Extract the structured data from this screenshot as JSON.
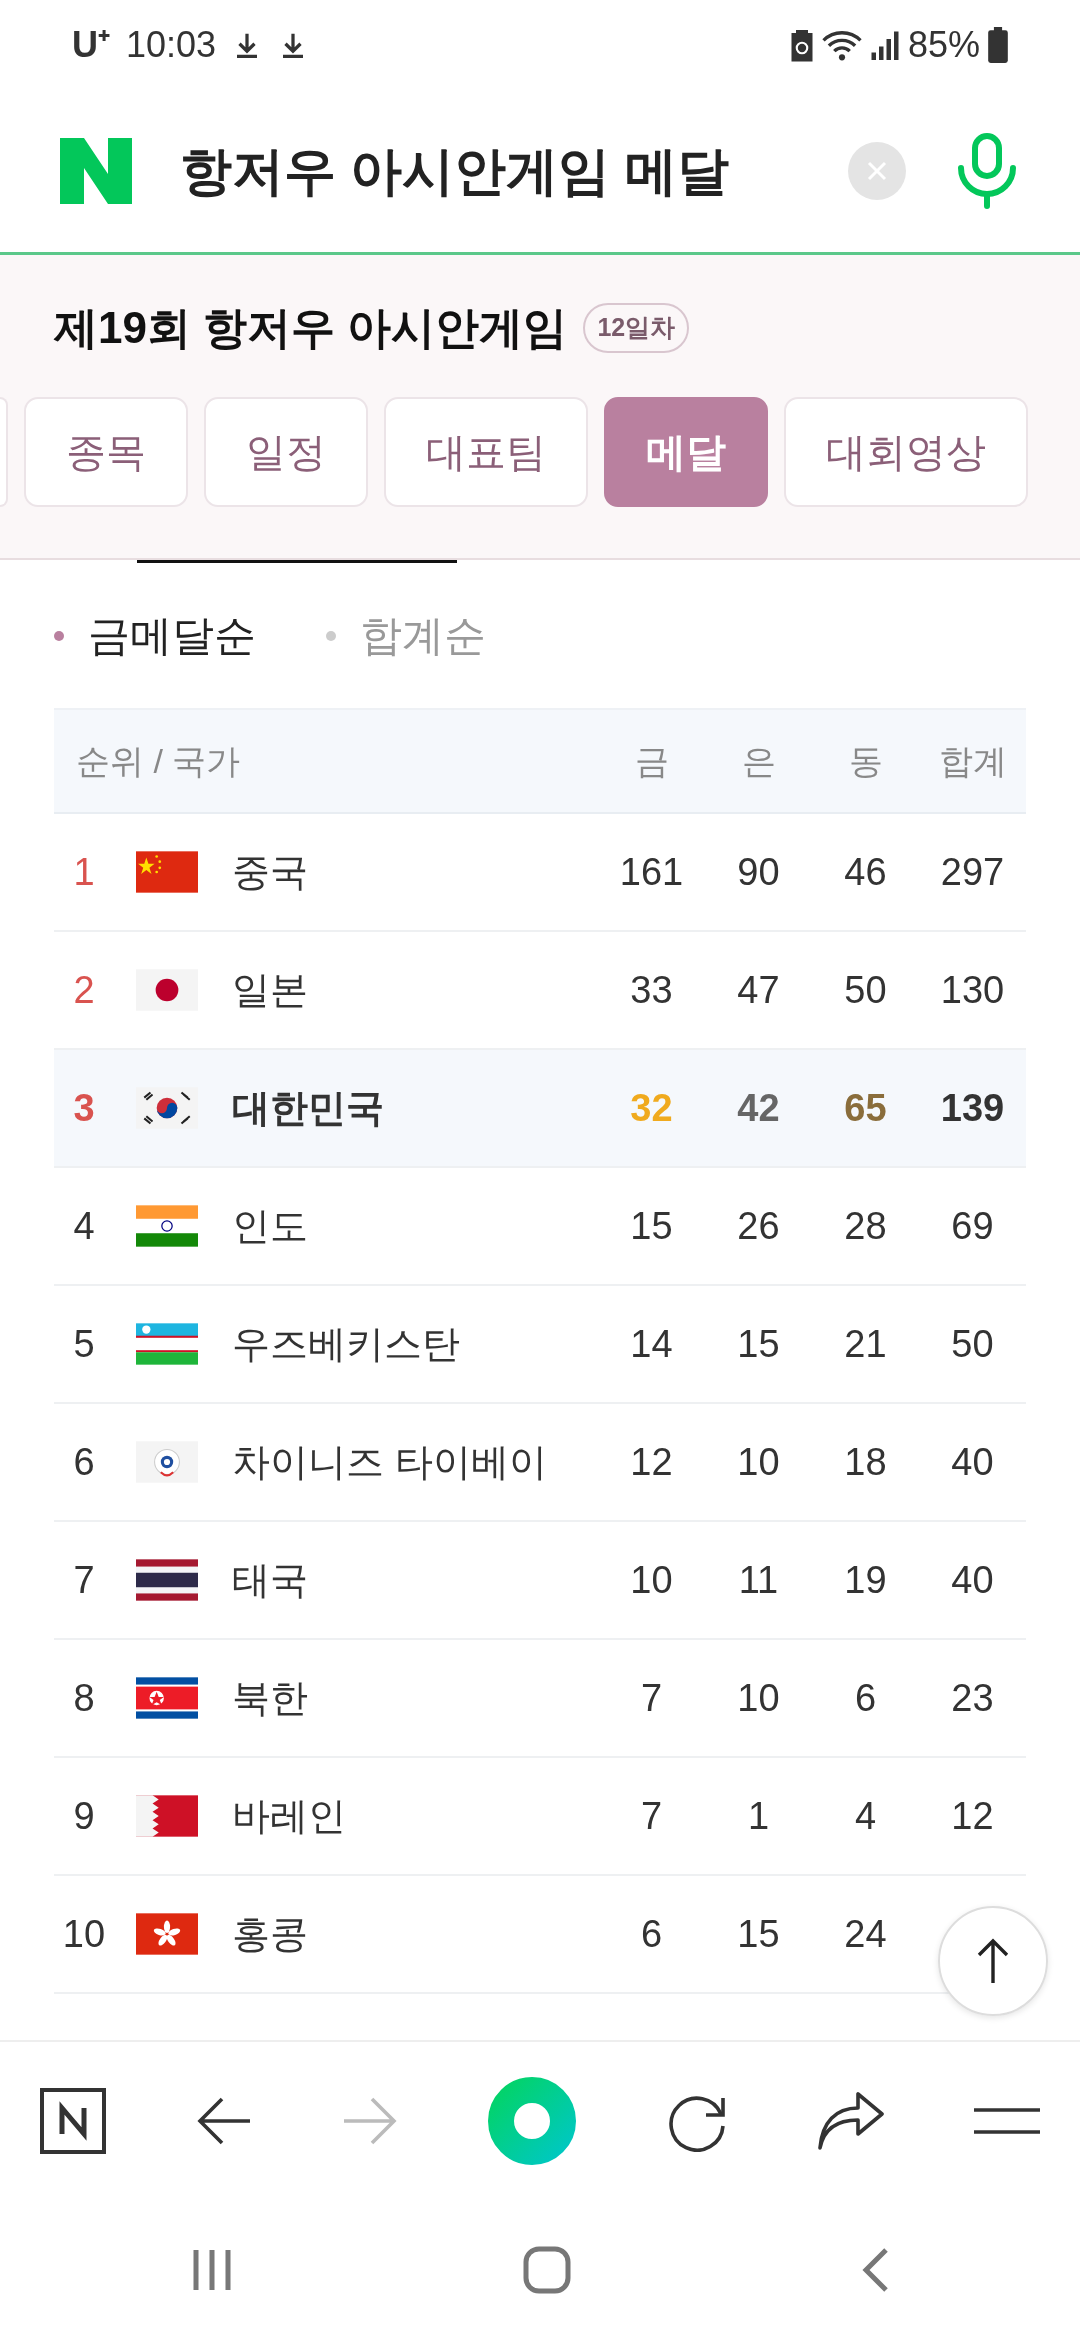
{
  "status_bar": {
    "carrier": "U⁺",
    "time": "10:03",
    "battery": "85%"
  },
  "search": {
    "query": "항저우 아시안게임 메달"
  },
  "event": {
    "title": "제19회 항저우 아시안게임",
    "day_badge": "12일차"
  },
  "tabs": [
    {
      "label": "종목",
      "selected": false
    },
    {
      "label": "일정",
      "selected": false
    },
    {
      "label": "대표팀",
      "selected": false
    },
    {
      "label": "메달",
      "selected": true
    },
    {
      "label": "대회영상",
      "selected": false
    }
  ],
  "sort_options": [
    {
      "label": "금메달순",
      "selected": true
    },
    {
      "label": "합계순",
      "selected": false
    }
  ],
  "table": {
    "columns": [
      "순위 / 국가",
      "금",
      "은",
      "동",
      "합계"
    ],
    "rows": [
      {
        "rank": "1",
        "country": "중국",
        "gold": "161",
        "silver": "90",
        "bronze": "46",
        "total": "297",
        "podium": true,
        "highlighted": false
      },
      {
        "rank": "2",
        "country": "일본",
        "gold": "33",
        "silver": "47",
        "bronze": "50",
        "total": "130",
        "podium": true,
        "highlighted": false
      },
      {
        "rank": "3",
        "country": "대한민국",
        "gold": "32",
        "silver": "42",
        "bronze": "65",
        "total": "139",
        "podium": true,
        "highlighted": true
      },
      {
        "rank": "4",
        "country": "인도",
        "gold": "15",
        "silver": "26",
        "bronze": "28",
        "total": "69",
        "podium": false,
        "highlighted": false
      },
      {
        "rank": "5",
        "country": "우즈베키스탄",
        "gold": "14",
        "silver": "15",
        "bronze": "21",
        "total": "50",
        "podium": false,
        "highlighted": false
      },
      {
        "rank": "6",
        "country": "차이니즈 타이베이",
        "gold": "12",
        "silver": "10",
        "bronze": "18",
        "total": "40",
        "podium": false,
        "highlighted": false
      },
      {
        "rank": "7",
        "country": "태국",
        "gold": "10",
        "silver": "11",
        "bronze": "19",
        "total": "40",
        "podium": false,
        "highlighted": false
      },
      {
        "rank": "8",
        "country": "북한",
        "gold": "7",
        "silver": "10",
        "bronze": "6",
        "total": "23",
        "podium": false,
        "highlighted": false
      },
      {
        "rank": "9",
        "country": "바레인",
        "gold": "7",
        "silver": "1",
        "bronze": "4",
        "total": "12",
        "podium": false,
        "highlighted": false
      },
      {
        "rank": "10",
        "country": "홍콩",
        "gold": "6",
        "silver": "15",
        "bronze": "24",
        "podium": false,
        "highlighted": false
      }
    ]
  },
  "browser_toolbar": {
    "forward_disabled": true
  }
}
